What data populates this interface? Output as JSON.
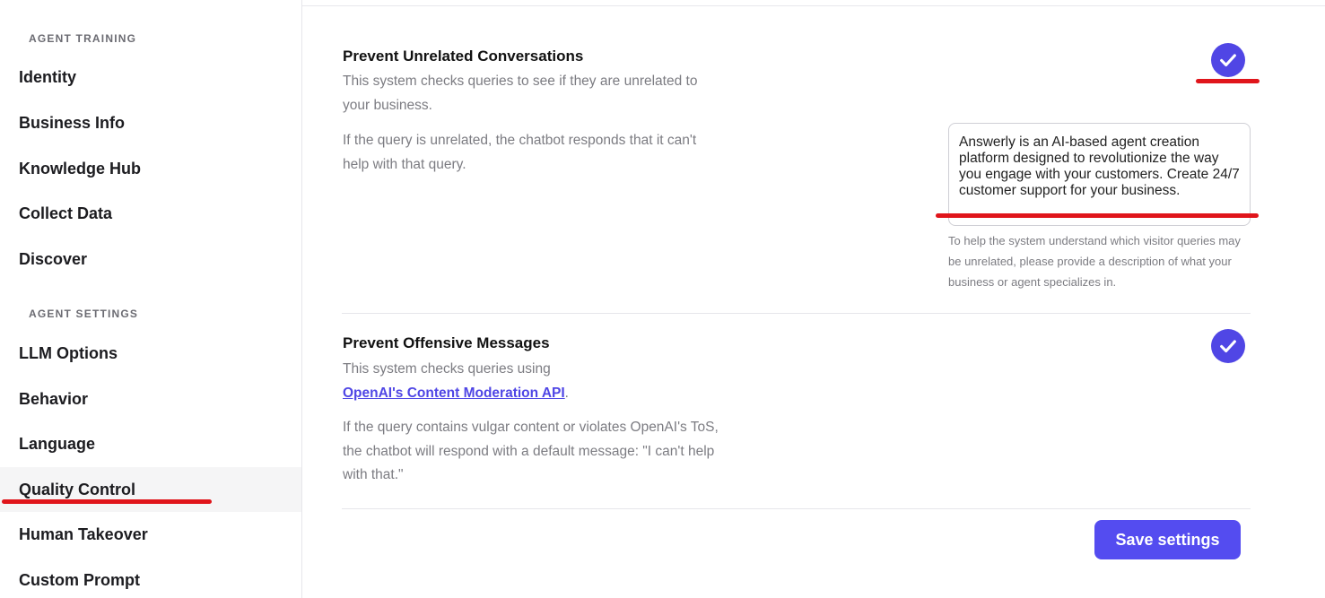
{
  "sidebar": {
    "sections": [
      {
        "heading": "AGENT TRAINING",
        "items": [
          "Identity",
          "Business Info",
          "Knowledge Hub",
          "Collect Data",
          "Discover"
        ]
      },
      {
        "heading": "AGENT SETTINGS",
        "items": [
          "LLM Options",
          "Behavior",
          "Language",
          "Quality Control",
          "Human Takeover",
          "Custom Prompt"
        ]
      }
    ],
    "active_item": "Quality Control"
  },
  "settings": {
    "unrelated": {
      "title": "Prevent Unrelated Conversations",
      "desc1": "This system checks queries to see if they are unrelated to your business.",
      "desc2": "If the query is unrelated, the chatbot responds that it can't help with that query.",
      "enabled": true,
      "checkbox_icon": "check-icon",
      "business_description": "Answerly is an AI-based agent creation platform designed to revolutionize the way you engage with your customers. Create 24/7 customer support for your business.",
      "help_text": "To help the system understand which visitor queries may be unrelated, please provide a description of what your business or agent specializes in."
    },
    "offensive": {
      "title": "Prevent Offensive Messages",
      "desc1_prefix": "This system checks queries using",
      "link_text": "OpenAI's Content Moderation API",
      "desc1_suffix": ".",
      "desc2": "If the query contains vulgar content or violates OpenAI's ToS, the chatbot will respond with a default message: \"I can't help with that.\"",
      "enabled": true,
      "checkbox_icon": "check-icon"
    }
  },
  "save_button": "Save settings",
  "colors": {
    "accent": "#544cf0",
    "annotation_red": "#e0151b",
    "active_bg": "#f5f5f6"
  }
}
